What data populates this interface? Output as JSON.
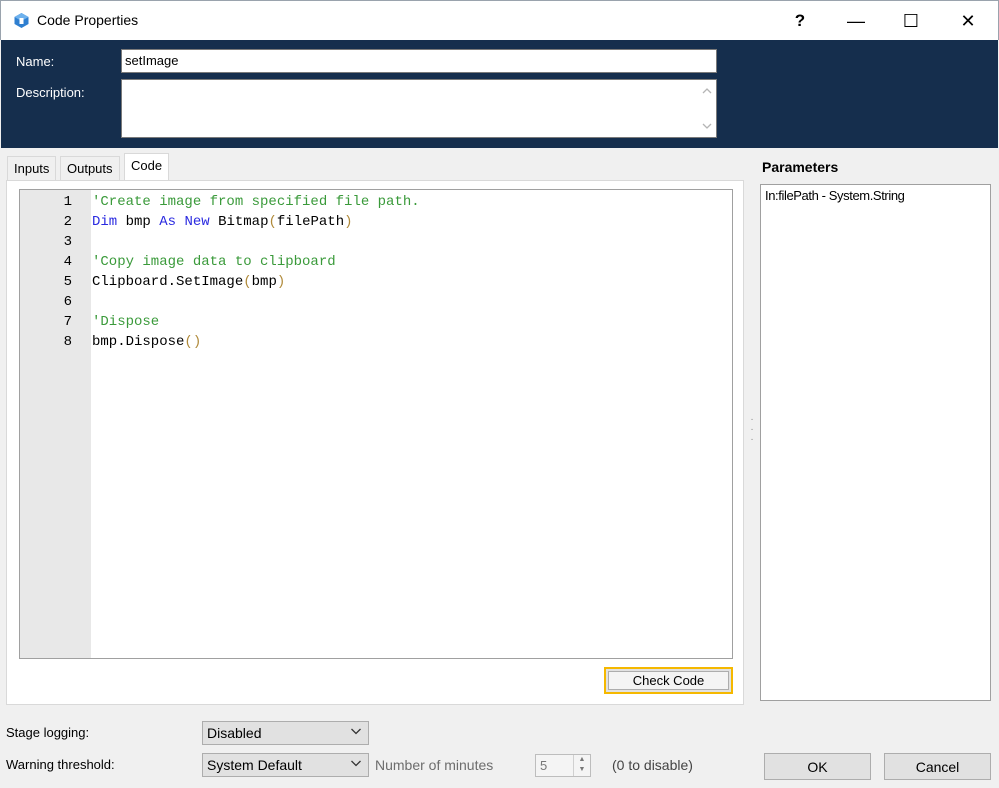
{
  "window": {
    "title": "Code Properties",
    "help_glyph": "?",
    "minimize_glyph": "—",
    "maximize_glyph": "☐",
    "close_glyph": "✕"
  },
  "header": {
    "name_label": "Name:",
    "name_value": "setImage",
    "description_label": "Description:",
    "description_value": ""
  },
  "tabs": [
    {
      "label": "Inputs",
      "active": false
    },
    {
      "label": "Outputs",
      "active": false
    },
    {
      "label": "Code",
      "active": true
    }
  ],
  "code": {
    "lines": [
      {
        "n": "1",
        "tokens": [
          {
            "t": "'Create image from specified file path.",
            "k": "comment"
          }
        ]
      },
      {
        "n": "2",
        "tokens": [
          {
            "t": "Dim",
            "k": "kw"
          },
          {
            "t": " bmp ",
            "k": "plain"
          },
          {
            "t": "As",
            "k": "kw"
          },
          {
            "t": " ",
            "k": "plain"
          },
          {
            "t": "New",
            "k": "kw"
          },
          {
            "t": " Bitmap",
            "k": "plain"
          },
          {
            "t": "(",
            "k": "paren"
          },
          {
            "t": "filePath",
            "k": "plain"
          },
          {
            "t": ")",
            "k": "paren"
          }
        ]
      },
      {
        "n": "3",
        "tokens": []
      },
      {
        "n": "4",
        "tokens": [
          {
            "t": "'Copy image data to clipboard",
            "k": "comment"
          }
        ]
      },
      {
        "n": "5",
        "tokens": [
          {
            "t": "Clipboard.SetImage",
            "k": "plain"
          },
          {
            "t": "(",
            "k": "paren"
          },
          {
            "t": "bmp",
            "k": "plain"
          },
          {
            "t": ")",
            "k": "paren"
          }
        ]
      },
      {
        "n": "6",
        "tokens": []
      },
      {
        "n": "7",
        "tokens": [
          {
            "t": "'Dispose",
            "k": "comment"
          }
        ]
      },
      {
        "n": "8",
        "tokens": [
          {
            "t": "bmp.Dispose",
            "k": "plain"
          },
          {
            "t": "()",
            "k": "paren"
          }
        ]
      }
    ],
    "check_button": "Check Code"
  },
  "parameters": {
    "title": "Parameters",
    "items": [
      "In:filePath - System.String"
    ]
  },
  "bottom": {
    "stage_logging_label": "Stage logging:",
    "stage_logging_value": "Disabled",
    "warning_label": "Warning threshold:",
    "warning_value": "System Default",
    "minutes_label": "Number of minutes",
    "minutes_value": "5",
    "disable_hint": "(0 to disable)",
    "ok_label": "OK",
    "cancel_label": "Cancel"
  },
  "colors": {
    "header_bg": "#152e4d",
    "comment": "#3a9a3a",
    "keyword": "#2a2ae0",
    "paren": "#b08a3a",
    "focus_border": "#f5b800"
  },
  "icons": {
    "app": "blueprism-app-icon",
    "scroll_up": "chevron-up-icon",
    "scroll_down": "chevron-down-icon",
    "dropdown": "chevron-down-icon",
    "spin": "spin-arrows-icon"
  }
}
